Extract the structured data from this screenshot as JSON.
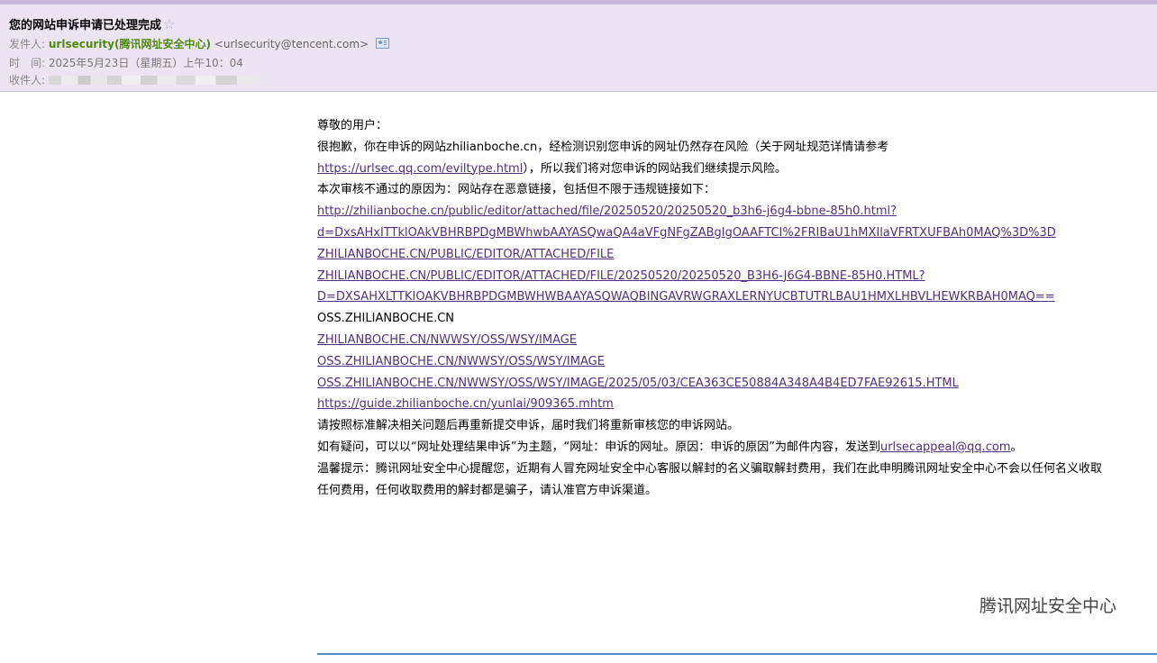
{
  "header": {
    "subject": "您的网站申诉申请已处理完成",
    "star": "☆",
    "from_label": "发件人:",
    "from_name": "urlsecurity",
    "from_org": "(腾讯网址安全中心)",
    "from_email": "<urlsecurity@tencent.com>",
    "time_label": "时　间:",
    "time_value": "2025年5月23日（星期五）上午10：04",
    "to_label": "收件人:"
  },
  "body": {
    "greeting": "尊敬的用户：",
    "p1a": "很抱歉，你在申诉的网站zhilianboche.cn，经检测识别您申诉的网址仍然存在风险（关于网址规范详情请参考",
    "p1_link": "https://urlsec.qq.com/eviltype.html",
    "p1b": "），所以我们将对您申诉的网站我们继续提示风险。",
    "reason": "本次审核不通过的原因为：网站存在恶意链接，包括但不限于违规链接如下：",
    "links": [
      "http://zhilianboche.cn/public/editor/attached/file/20250520/20250520_b3h6-j6g4-bbne-85h0.html?",
      "d=DxsAHxITTklOAkVBHRBPDgMBWhwbAAYASQwaQA4aVFgNFgZABgIgOAAFTCI%2FRIBaU1hMXIlaVFRTXUFBAh0MAQ%3D%3D",
      "ZHILIANBOCHE.CN/PUBLIC/EDITOR/ATTACHED/FILE",
      "ZHILIANBOCHE.CN/PUBLIC/EDITOR/ATTACHED/FILE/20250520/20250520_B3H6-J6G4-BBNE-85H0.HTML?",
      "D=DXSAHXLTTKIOAKVBHRBPDGMBWHWBAAYASQWAQBINGAVRWGRAXLERNYUCBTUTRLBAU1HMXLHBVLHEWKRBAH0MAQ=="
    ],
    "plain_domain": "OSS.ZHILIANBOCHE.CN",
    "links2": [
      "ZHILIANBOCHE.CN/NWWSY/OSS/WSY/IMAGE",
      "OSS.ZHILIANBOCHE.CN/NWWSY/OSS/WSY/IMAGE",
      "OSS.ZHILIANBOCHE.CN/NWWSY/OSS/WSY/IMAGE/2025/05/03/CEA363CE50884A348A4B4ED7FAE92615.HTML",
      "https://guide.zhilianboche.cn/yunlai/909365.mhtm"
    ],
    "instruction": "请按照标准解决相关问题后再重新提交申诉，届时我们将重新审核您的申诉网站。",
    "question_a": "如有疑问，可以以“网址处理结果申诉”为主题，“网址：申诉的网址。原因：申诉的原因”为邮件内容，发送到",
    "question_email": "urlsecappeal@qq.com",
    "question_b": "。",
    "warning1": "温馨提示：腾讯网址安全中心提醒您，近期有人冒充网址安全中心客服以解封的名义骗取解封费用，我们在此申明腾讯网址安全中心不会以任何名义收取",
    "warning2": "任何费用，任何收取费用的解封都是骗子，请认准官方申诉渠道。"
  },
  "signature": "腾讯网址安全中心"
}
